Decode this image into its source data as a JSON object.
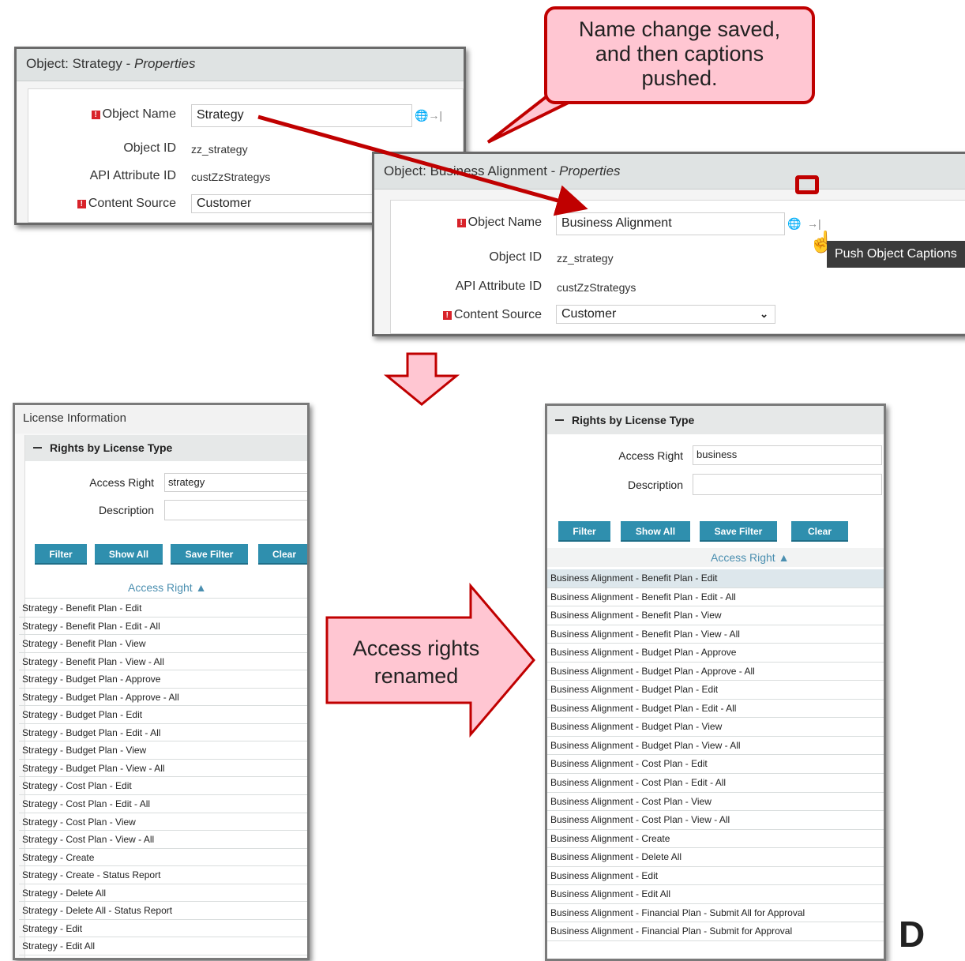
{
  "props_strategy": {
    "title": "Object: Strategy - ",
    "title_suffix": "Properties",
    "object_name_label": "Object Name",
    "object_name_value": "Strategy",
    "object_id_label": "Object ID",
    "object_id_value": "zz_strategy",
    "api_label": "API Attribute ID",
    "api_value": "custZzStrategys",
    "content_source_label": "Content Source",
    "content_source_value": "Customer"
  },
  "props_business": {
    "title": "Object: Business Alignment - ",
    "title_suffix": "Properties",
    "object_name_label": "Object Name",
    "object_name_value": "Business Alignment",
    "object_id_label": "Object ID",
    "object_id_value": "zz_strategy",
    "api_label": "API Attribute ID",
    "api_value": "custZzStrategys",
    "content_source_label": "Content Source",
    "content_source_value": "Customer",
    "tooltip": "Push Object Captions"
  },
  "callouts": {
    "saved": "Name change saved, and then captions pushed.",
    "renamed": "Access rights renamed"
  },
  "colors": {
    "accent_red": "#c00000",
    "callout_fill": "#ffc6d2",
    "button_blue": "#2f8fae"
  },
  "icons": {
    "globe": "globe-icon",
    "push": "push-arrow-icon",
    "cursor": "hand-cursor-icon",
    "required": "required-icon"
  },
  "license_left": {
    "header": "License Information",
    "section": "Rights by License Type",
    "access_right_label": "Access Right",
    "access_right_value": "strategy",
    "description_label": "Description",
    "description_value": "",
    "buttons": {
      "filter": "Filter",
      "show_all": "Show All",
      "save_filter": "Save Filter",
      "clear": "Clear"
    },
    "column": "Access Right ▲",
    "rows": [
      "Strategy - Benefit Plan - Edit",
      "Strategy - Benefit Plan - Edit - All",
      "Strategy - Benefit Plan - View",
      "Strategy - Benefit Plan - View - All",
      "Strategy - Budget Plan - Approve",
      "Strategy - Budget Plan - Approve - All",
      "Strategy - Budget Plan - Edit",
      "Strategy - Budget Plan - Edit - All",
      "Strategy - Budget Plan - View",
      "Strategy - Budget Plan - View - All",
      "Strategy - Cost Plan - Edit",
      "Strategy - Cost Plan - Edit - All",
      "Strategy - Cost Plan - View",
      "Strategy - Cost Plan - View - All",
      "Strategy - Create",
      "Strategy - Create - Status Report",
      "Strategy - Delete All",
      "Strategy - Delete All - Status Report",
      "Strategy - Edit",
      "Strategy - Edit All"
    ]
  },
  "license_right": {
    "section": "Rights by License Type",
    "access_right_label": "Access Right",
    "access_right_value": "business",
    "description_label": "Description",
    "description_value": "",
    "buttons": {
      "filter": "Filter",
      "show_all": "Show All",
      "save_filter": "Save Filter",
      "clear": "Clear"
    },
    "column": "Access Right ▲",
    "rows": [
      "Business Alignment - Benefit Plan - Edit",
      "Business Alignment - Benefit Plan - Edit - All",
      "Business Alignment - Benefit Plan - View",
      "Business Alignment - Benefit Plan - View - All",
      "Business Alignment - Budget Plan - Approve",
      "Business Alignment - Budget Plan - Approve - All",
      "Business Alignment - Budget Plan - Edit",
      "Business Alignment - Budget Plan - Edit - All",
      "Business Alignment - Budget Plan - View",
      "Business Alignment - Budget Plan - View - All",
      "Business Alignment - Cost Plan - Edit",
      "Business Alignment - Cost Plan - Edit - All",
      "Business Alignment - Cost Plan - View",
      "Business Alignment - Cost Plan - View - All",
      "Business Alignment - Create",
      "Business Alignment - Delete All",
      "Business Alignment - Edit",
      "Business Alignment - Edit All",
      "Business Alignment - Financial Plan - Submit All for Approval",
      "Business Alignment - Financial Plan - Submit for Approval"
    ]
  }
}
